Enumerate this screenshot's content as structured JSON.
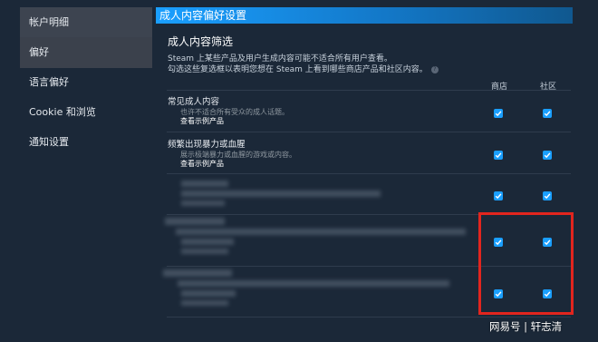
{
  "sidebar": {
    "items": [
      {
        "label": "帐户明细"
      },
      {
        "label": "偏好"
      },
      {
        "label": "语言偏好"
      },
      {
        "label": "Cookie 和浏览"
      },
      {
        "label": "通知设置"
      }
    ]
  },
  "panel": {
    "title": "成人内容偏好设置",
    "section_title": "成人内容筛选",
    "desc_line1": "Steam 上某些产品及用户生成内容可能不适合所有用户查看。",
    "desc_line2": "勾选这些复选框以表明您想在 Steam 上看到哪些商店产品和社区内容。",
    "help_glyph": "?",
    "columns": {
      "store": "商店",
      "community": "社区"
    },
    "rows": [
      {
        "title": "常见成人内容",
        "subtitle": "也许不适合所有受众的成人话题。",
        "link": "查看示例产品",
        "store_checked": true,
        "community_checked": true
      },
      {
        "title": "频繁出现暴力或血腥",
        "subtitle": "展示极端暴力或血腥的游戏或内容。",
        "link": "查看示例产品",
        "store_checked": true,
        "community_checked": true
      },
      {
        "title": "",
        "subtitle": "",
        "link": "",
        "store_checked": true,
        "community_checked": true
      },
      {
        "title": "",
        "subtitle": "",
        "link": "",
        "store_checked": true,
        "community_checked": true
      },
      {
        "title": "",
        "subtitle": "",
        "link": "",
        "store_checked": true,
        "community_checked": true
      }
    ]
  },
  "watermark": "网易号 | 轩志清",
  "colors": {
    "accent": "#1a9fff",
    "background": "#1b2838",
    "highlight_box": "#e2251e"
  }
}
